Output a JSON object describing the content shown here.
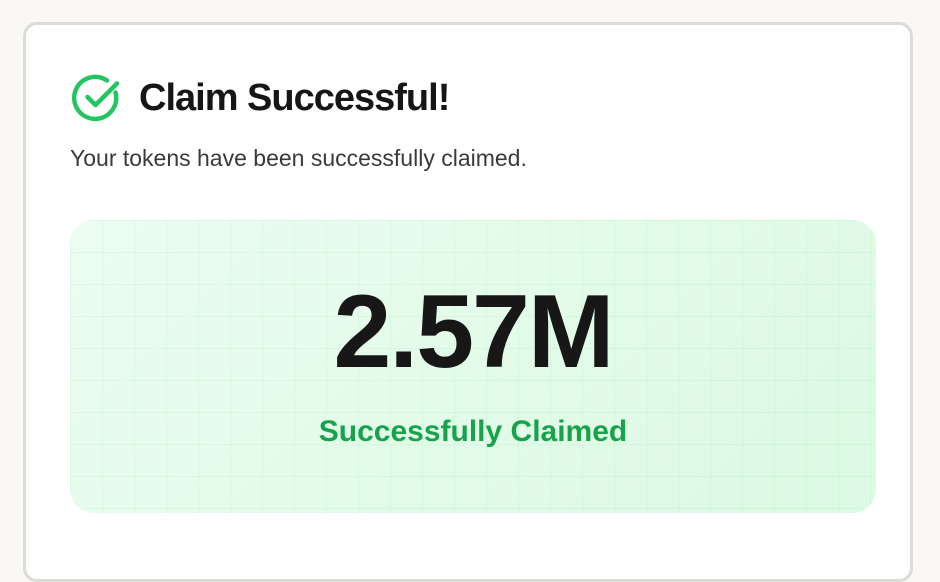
{
  "card": {
    "title": "Claim Successful!",
    "subtitle": "Your tokens have been successfully claimed.",
    "icon": "check-circle-icon"
  },
  "claim": {
    "amount": "2.57M",
    "status_label": "Successfully Claimed"
  },
  "colors": {
    "accent_green": "#22c55e",
    "label_green": "#16a34a",
    "panel_bg": "#e3fbe9",
    "title_text": "#161616"
  }
}
